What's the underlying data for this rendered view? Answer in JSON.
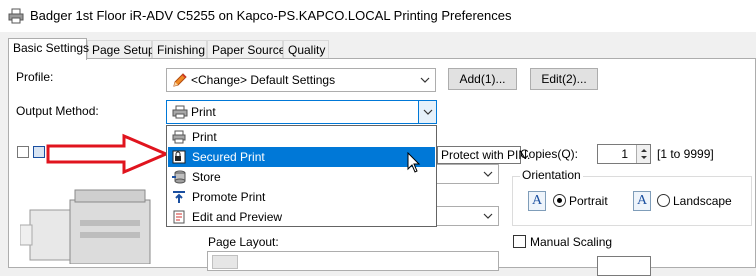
{
  "window": {
    "title": "Badger 1st Floor iR-ADV C5255 on Kapco-PS.KAPCO.LOCAL Printing Preferences"
  },
  "tabs": [
    {
      "label": "Basic Settings",
      "active": true
    },
    {
      "label": "Page Setup"
    },
    {
      "label": "Finishing"
    },
    {
      "label": "Paper Source"
    },
    {
      "label": "Quality"
    }
  ],
  "profile": {
    "label": "Profile:",
    "value": "<Change> Default Settings",
    "add_label": "Add(1)...",
    "edit_label": "Edit(2)..."
  },
  "output_method": {
    "label": "Output Method:",
    "value": "Print",
    "options": [
      {
        "label": "Print",
        "icon": "printer-icon"
      },
      {
        "label": "Secured Print",
        "icon": "secured-print-icon",
        "highlighted": true
      },
      {
        "label": "Store",
        "icon": "store-icon"
      },
      {
        "label": "Promote Print",
        "icon": "promote-print-icon"
      },
      {
        "label": "Edit and Preview",
        "icon": "edit-preview-icon"
      }
    ]
  },
  "tooltip": {
    "text": "Protect with PIN."
  },
  "copies": {
    "label": "Copies(Q):",
    "value": "1",
    "range": "[1 to 9999]"
  },
  "orientation": {
    "label": "Orientation",
    "portrait_label": "Portrait",
    "landscape_label": "Landscape",
    "selected": "Portrait"
  },
  "page_layout": {
    "label": "Page Layout:"
  },
  "manual_scaling": {
    "label": "Manual Scaling",
    "checked": false
  },
  "colors": {
    "accent": "#0078d7",
    "arrow": "#e0141e"
  }
}
